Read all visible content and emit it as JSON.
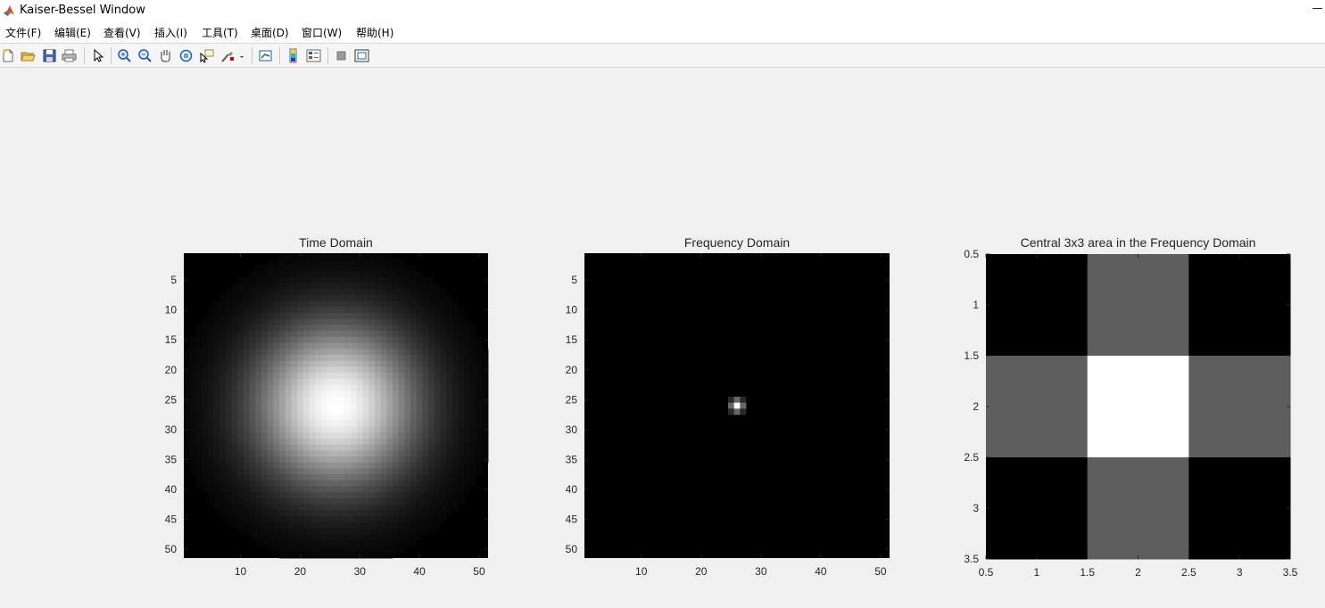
{
  "window": {
    "title": "Kaiser-Bessel Window",
    "minimize_glyph": "—"
  },
  "menubar": {
    "items": [
      "文件(F)",
      "编辑(E)",
      "查看(V)",
      "插入(I)",
      "工具(T)",
      "桌面(D)",
      "窗口(W)",
      "帮助(H)"
    ]
  },
  "toolbar": {
    "icons": [
      "new-figure-icon",
      "open-file-icon",
      "save-icon",
      "print-icon",
      "edit-plot-arrow-icon",
      "zoom-in-icon",
      "zoom-out-icon",
      "pan-hand-icon",
      "rotate-3d-icon",
      "data-cursor-icon",
      "brush-icon",
      "link-plot-icon",
      "colorbar-icon",
      "legend-icon",
      "hide-plot-tools-icon",
      "show-plot-tools-icon"
    ]
  },
  "chart_data": [
    {
      "type": "heatmap",
      "title": "Time Domain",
      "description": "Gray-scale image of 2D Kaiser-Bessel window, 51x51, peak at center",
      "size": [
        51,
        51
      ],
      "center": [
        26,
        26
      ],
      "xlim": [
        0.5,
        51.5
      ],
      "ylim": [
        0.5,
        51.5
      ],
      "y_reversed": true,
      "xticks": [
        10,
        20,
        30,
        40,
        50
      ],
      "yticks": [
        5,
        10,
        15,
        20,
        25,
        30,
        35,
        40,
        45,
        50
      ],
      "colormap": "gray",
      "grid": false
    },
    {
      "type": "heatmap",
      "title": "Frequency Domain",
      "description": "Gray-scale magnitude of frequency response, 51x51, bright only near center",
      "size": [
        51,
        51
      ],
      "center": [
        26,
        26
      ],
      "xlim": [
        0.5,
        51.5
      ],
      "ylim": [
        0.5,
        51.5
      ],
      "y_reversed": true,
      "xticks": [
        10,
        20,
        30,
        40,
        50
      ],
      "yticks": [
        5,
        10,
        15,
        20,
        25,
        30,
        35,
        40,
        45,
        50
      ],
      "colormap": "gray",
      "grid": false
    },
    {
      "type": "heatmap",
      "title": "Central 3x3 area in the Frequency Domain",
      "matrix": [
        [
          0,
          0.37,
          0
        ],
        [
          0.37,
          1,
          0.37
        ],
        [
          0,
          0.37,
          0
        ]
      ],
      "xlim": [
        0.5,
        3.5
      ],
      "ylim": [
        0.5,
        3.5
      ],
      "y_reversed": true,
      "xticks": [
        0.5,
        1,
        1.5,
        2,
        2.5,
        3,
        3.5
      ],
      "yticks": [
        0.5,
        1,
        1.5,
        2,
        2.5,
        3,
        3.5
      ],
      "colormap": "gray",
      "grid": false
    }
  ]
}
